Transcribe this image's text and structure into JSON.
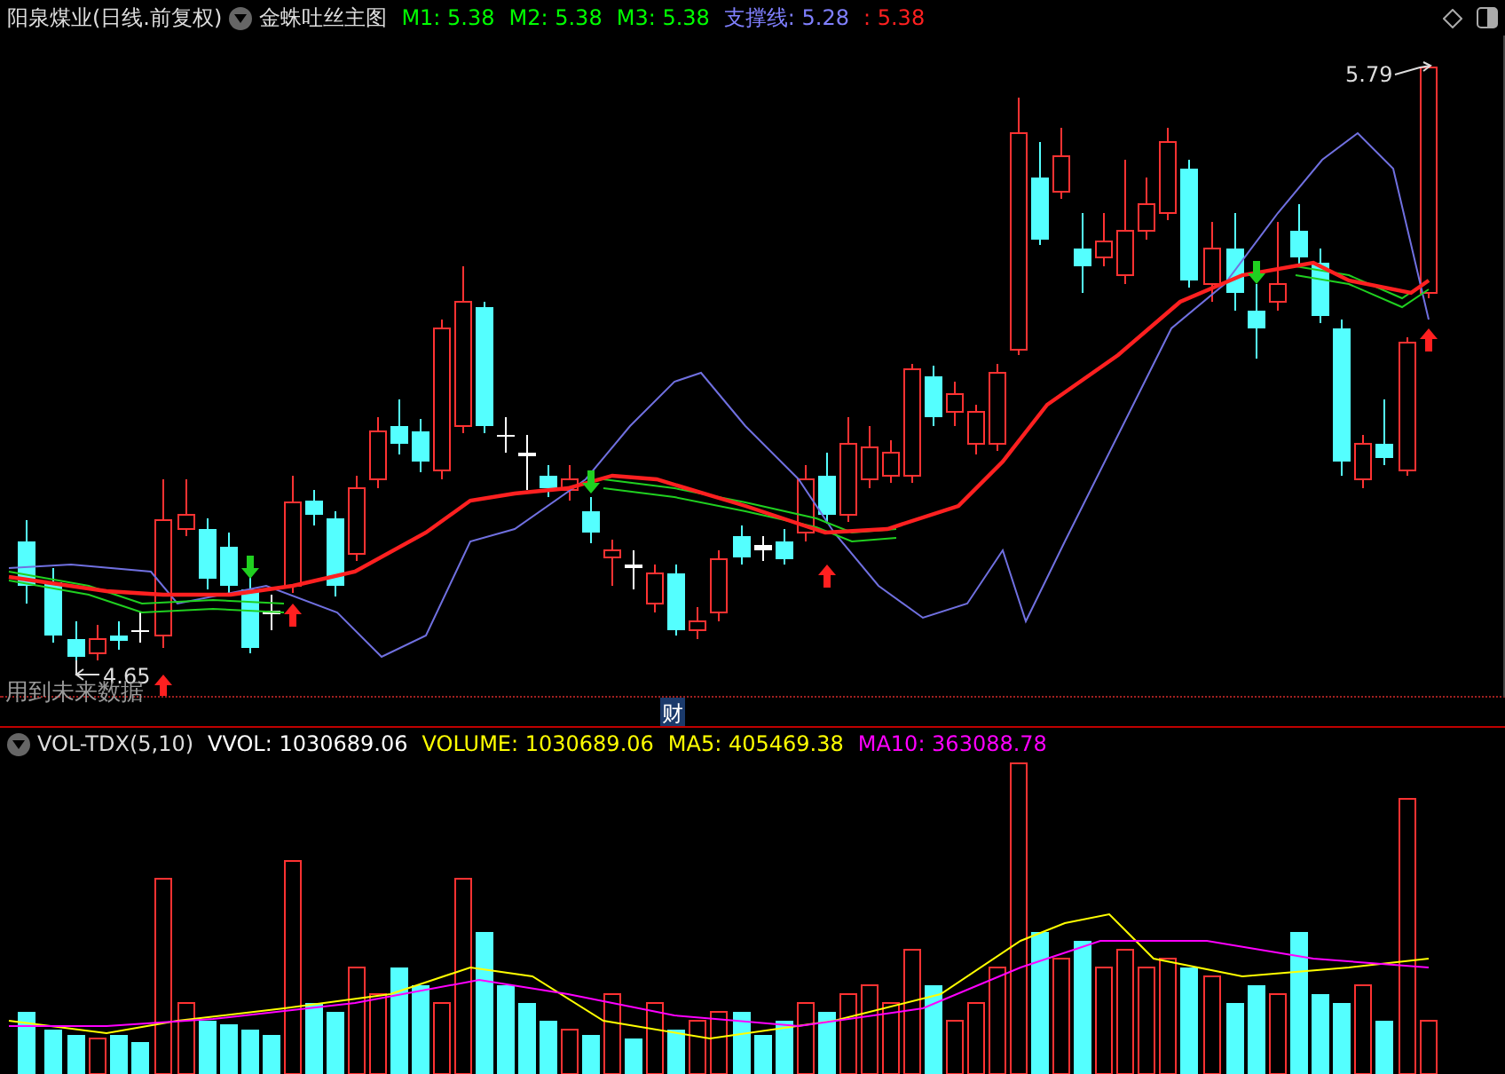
{
  "header": {
    "stock": "阳泉煤业(日线.前复权)",
    "indicator": "金蛛吐丝主图",
    "legend": [
      {
        "text": "M1: 5.38",
        "color": "#00ff00"
      },
      {
        "text": "M2: 5.38",
        "color": "#00ff00"
      },
      {
        "text": "M3: 5.38",
        "color": "#00ff00"
      },
      {
        "text": "支撑线: 5.28",
        "color": "#8080ff"
      },
      {
        "text": ": 5.38",
        "color": "#ff2020"
      }
    ]
  },
  "main_chart": {
    "high_label": "5.79",
    "low_label": "4.65",
    "warning": "用到未来数据",
    "axis_marker": "财"
  },
  "volume_panel": {
    "indicator": "VOL-TDX(5,10)",
    "legend": [
      {
        "text": "VVOL: 1030689.06",
        "color": "#ffffff"
      },
      {
        "text": "VOLUME: 1030689.06",
        "color": "#ffff00"
      },
      {
        "text": "MA5: 405469.38",
        "color": "#ffff00"
      },
      {
        "text": "MA10: 363088.78",
        "color": "#ff00ff"
      }
    ]
  }
}
